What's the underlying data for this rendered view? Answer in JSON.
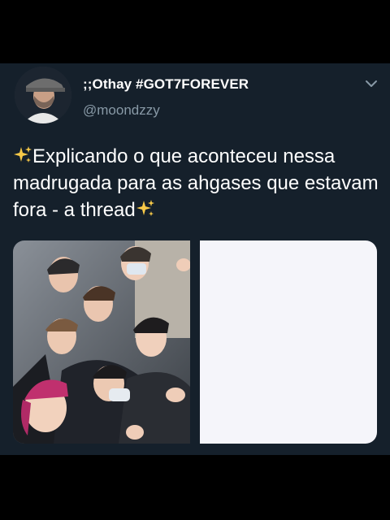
{
  "tweet": {
    "display_name": ";;Othay #GOT7FOREVER",
    "handle": "@moondzzy",
    "text": "Explicando o que aconteceu nessa madrugada para as ahgases que estavam fora - a thread",
    "icons": [
      "avatar",
      "chevron-down-icon",
      "sparkles-icon",
      "sparkles-icon"
    ]
  },
  "colors": {
    "background": "#15202b",
    "frame": "#000000",
    "text": "#ffffff",
    "secondary_text": "#8899a6",
    "sparkle": "#f7c948"
  }
}
